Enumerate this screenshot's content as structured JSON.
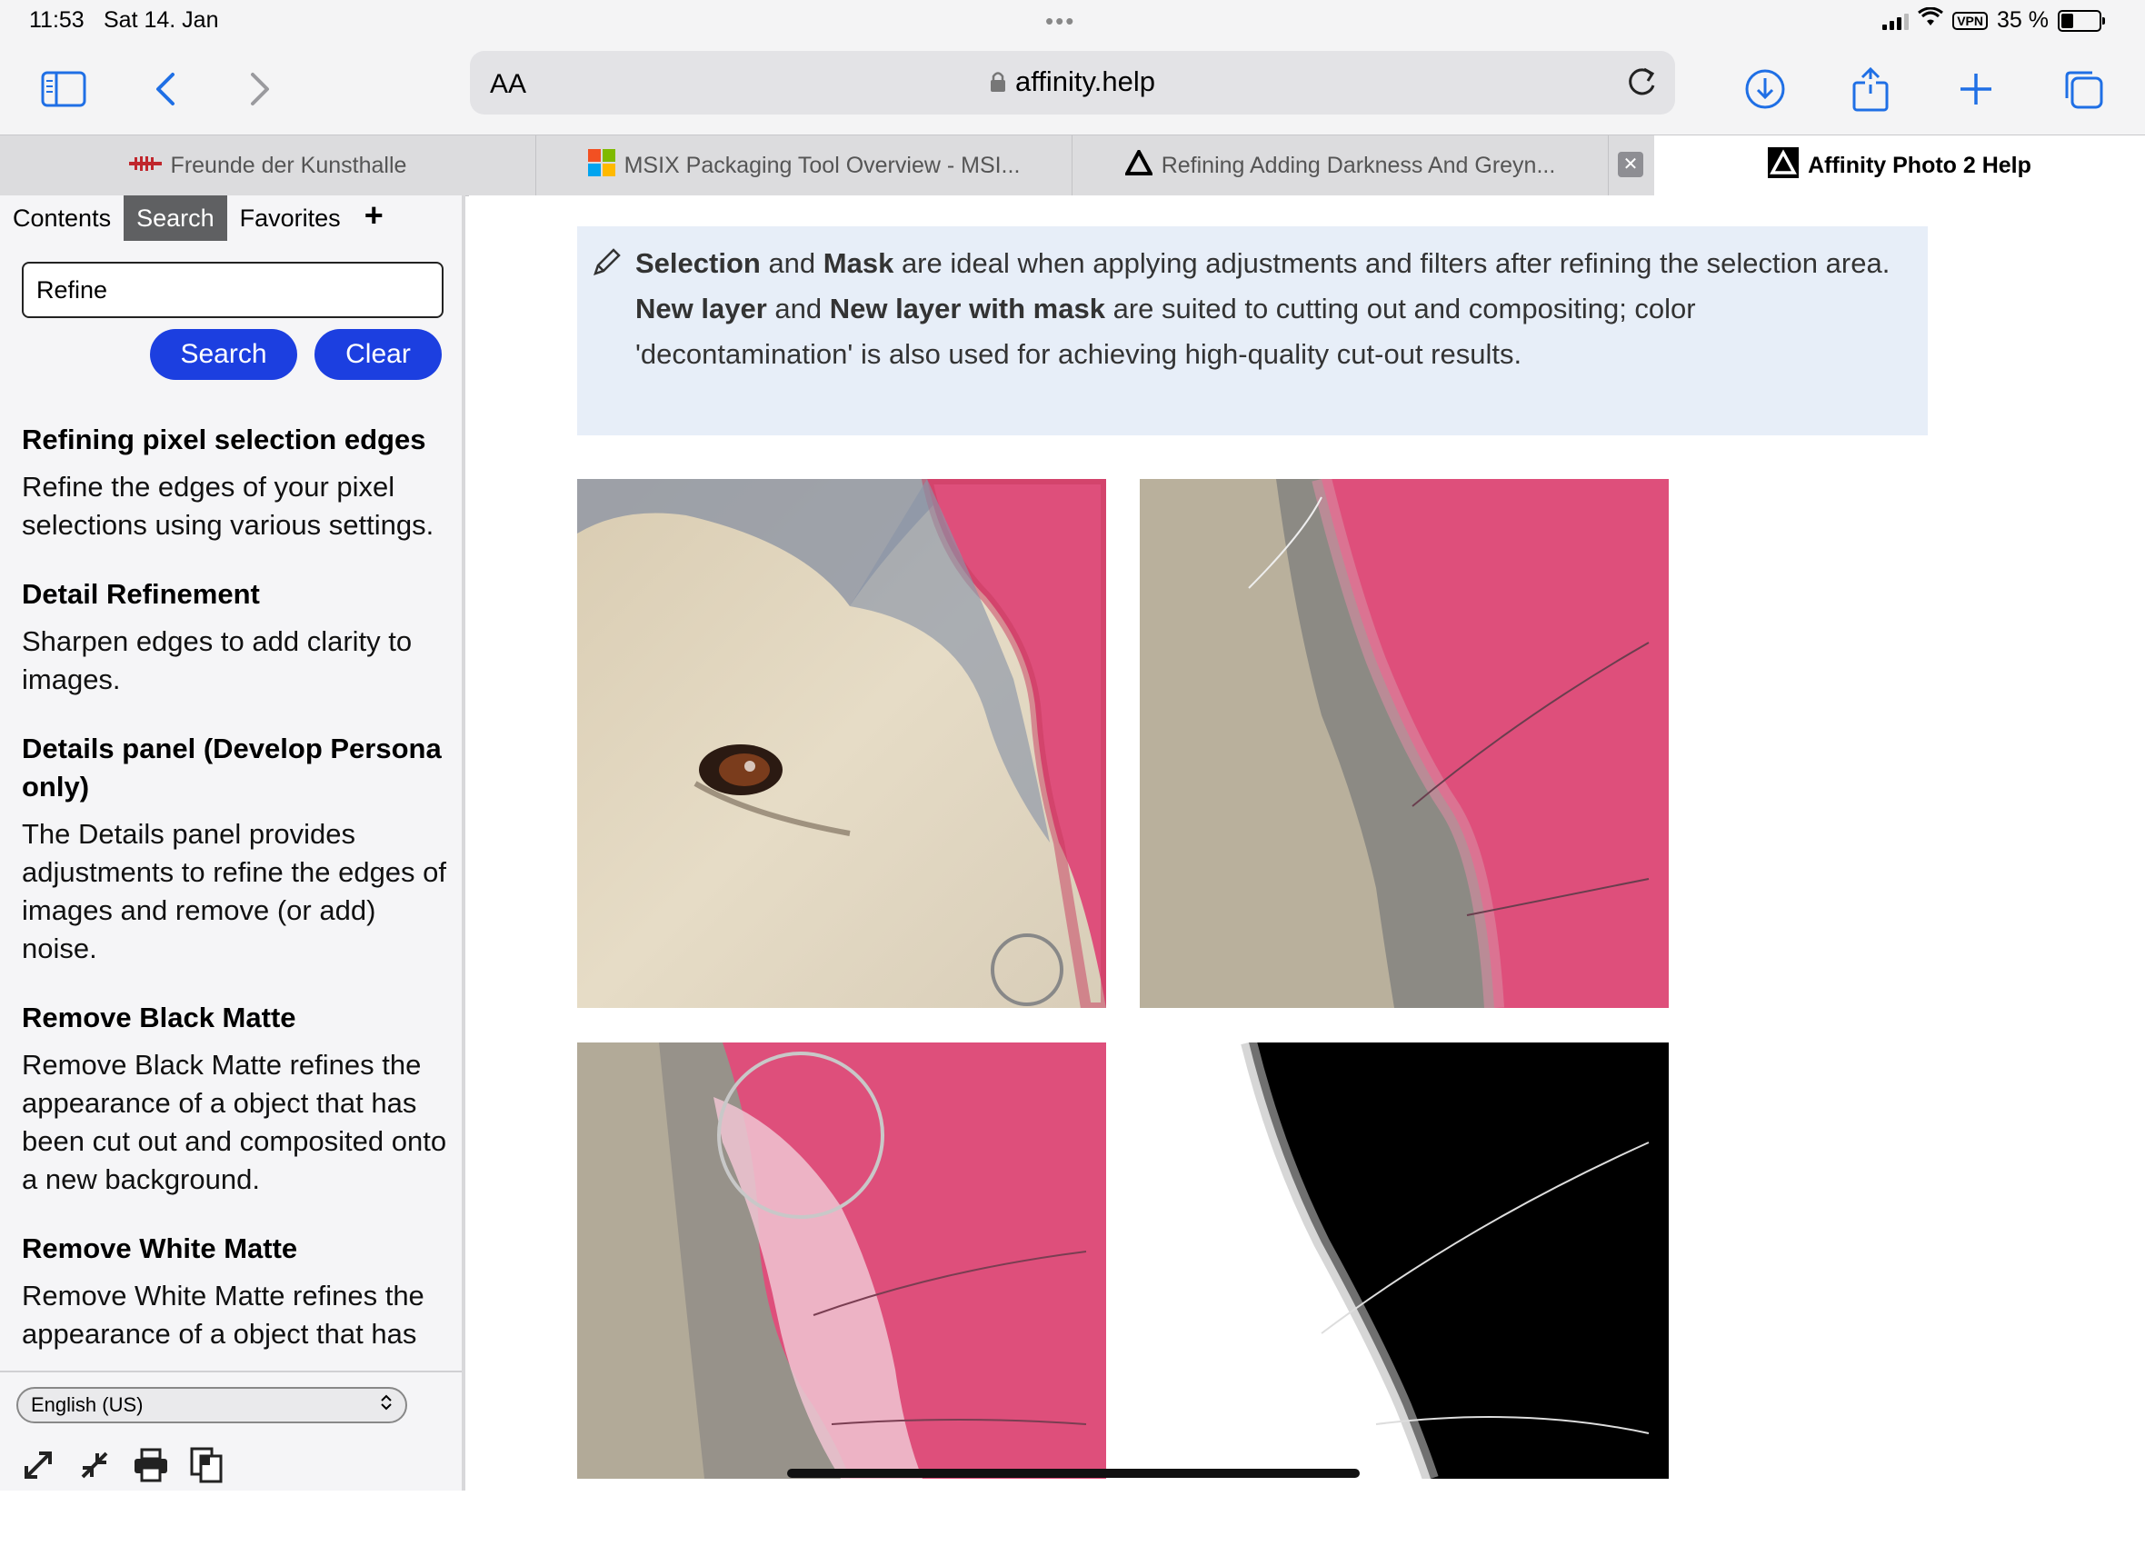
{
  "status": {
    "time": "11:53",
    "date": "Sat 14. Jan",
    "dots": "•••",
    "vpn": "VPN",
    "battery_text": "35 %",
    "battery_level": 0.35
  },
  "toolbar": {
    "reader_label": "AA",
    "url": "affinity.help"
  },
  "tabs": [
    {
      "title": "Freunde der Kunsthalle"
    },
    {
      "title": "MSIX Packaging Tool Overview - MSI..."
    },
    {
      "title": "Refining Adding Darkness And Greyn..."
    },
    {
      "title": "Affinity Photo 2 Help"
    }
  ],
  "sidebar": {
    "tabs": [
      "Contents",
      "Search",
      "Favorites"
    ],
    "plus": "+",
    "search_value": "Refine",
    "search_button": "Search",
    "clear_button": "Clear",
    "results": [
      {
        "title": "Refining pixel selection edges",
        "desc": "Refine the edges of your pixel selections using various settings."
      },
      {
        "title": "Detail Refinement",
        "desc": "Sharpen edges to add clarity to images."
      },
      {
        "title": "Details panel (Develop Persona only)",
        "desc": "The Details panel provides adjustments to refine the edges of images and remove (or add) noise."
      },
      {
        "title": "Remove Black Matte",
        "desc": "Remove Black Matte refines the appearance of a object that has been cut out and composited onto a new background."
      },
      {
        "title": "Remove White Matte",
        "desc": "Remove White Matte refines the appearance of a object that has"
      }
    ],
    "language": "English (US)"
  },
  "note": {
    "b1": "Selection",
    "t1": " and ",
    "b2": "Mask",
    "t2": " are ideal when applying adjustments and filters after refining the selection area. ",
    "b3": "New layer",
    "t3": " and ",
    "b4": "New layer with mask",
    "t4": " are suited to cutting out and compositing; color 'decontamination' is also used for achieving high-quality cut-out results."
  },
  "colors": {
    "accent_blue": "#1c3fe0",
    "ios_blue": "#1f6fe5",
    "mask_pink": "#de4f7b",
    "note_bg": "#e7eef8"
  }
}
